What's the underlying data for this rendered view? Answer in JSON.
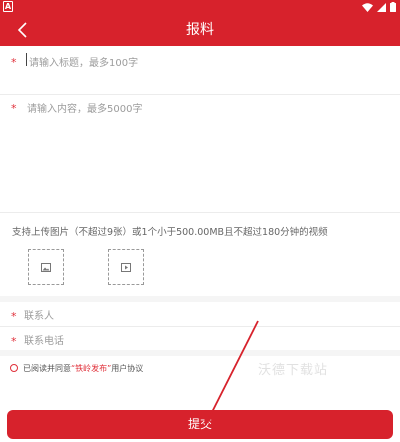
{
  "status_bar": {
    "left_badge": "A",
    "icons": [
      "wifi-icon",
      "signal-icon",
      "battery-icon"
    ]
  },
  "header": {
    "title": "报料",
    "back_icon": "chevron-left-icon"
  },
  "form": {
    "title_placeholder": "请输入标题，最多100字",
    "content_placeholder": "请输入内容，最多5000字",
    "upload_hint": "支持上传图片（不超过9张）或1个小于500.00MB且不超过180分钟的视频",
    "upload_image_icon": "image-icon",
    "upload_video_icon": "video-icon",
    "contact_name_placeholder": "联系人",
    "contact_phone_placeholder": "联系电话",
    "required_mark": "*"
  },
  "agreement": {
    "prefix": "已阅读并同意",
    "link": "“铁岭发布”",
    "suffix": "用户协议"
  },
  "submit": {
    "label": "提交"
  },
  "watermark": {
    "text": "沃德下载站"
  },
  "colors": {
    "brand_red": "#d7222c",
    "required_red": "#e0303a",
    "placeholder_gray": "#9c9c9c"
  }
}
